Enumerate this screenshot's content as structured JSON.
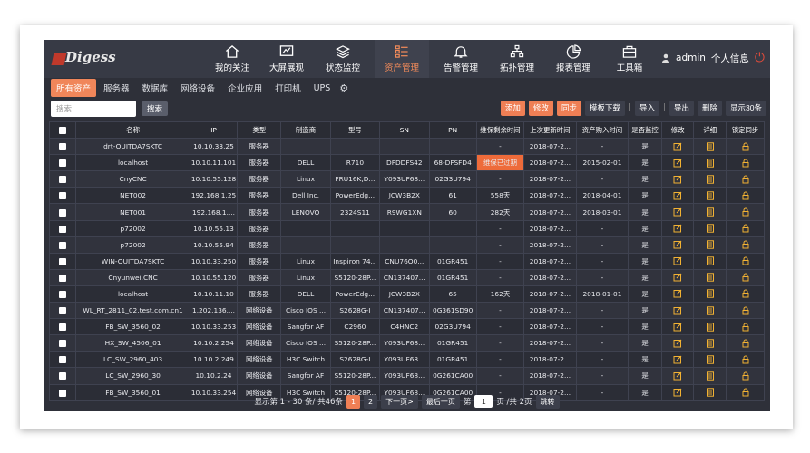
{
  "logo": {
    "text": "Digess"
  },
  "nav": [
    {
      "label": "我的关注",
      "icon": "home-icon"
    },
    {
      "label": "大屏展现",
      "icon": "screen-chart-icon"
    },
    {
      "label": "状态监控",
      "icon": "layers-icon"
    },
    {
      "label": "资产管理",
      "icon": "list-icon",
      "active": true
    },
    {
      "label": "告警管理",
      "icon": "bell-icon"
    },
    {
      "label": "拓扑管理",
      "icon": "topology-icon"
    },
    {
      "label": "报表管理",
      "icon": "pie-report-icon"
    },
    {
      "label": "工具箱",
      "icon": "toolbox-icon"
    }
  ],
  "user": {
    "name": "admin",
    "profile": "个人信息"
  },
  "subtabs": [
    "所有资产",
    "服务器",
    "数据库",
    "网络设备",
    "企业应用",
    "打印机",
    "UPS"
  ],
  "toolbar": {
    "search_placeholder": "搜索",
    "search_label": "搜索",
    "add": "添加",
    "edit": "修改",
    "sync": "同步",
    "template_download": "模板下载",
    "import": "导入",
    "export": "导出",
    "delete": "删除",
    "show30": "显示30条"
  },
  "table": {
    "headers": [
      "",
      "名称",
      "IP",
      "类型",
      "制造商",
      "型号",
      "SN",
      "PN",
      "维保剩余时间",
      "上次更新时间",
      "资产购入时间",
      "是否监控",
      "修改",
      "详细",
      "锁定同步"
    ],
    "rows": [
      [
        "drt-OUITDA7SKTC",
        "10.10.33.25",
        "服务器",
        "",
        "",
        "",
        "",
        "-",
        "2018-07-2...",
        "-",
        "是"
      ],
      [
        "localhost",
        "10.10.11.101",
        "服务器",
        "DELL",
        "R710",
        "DFDDFS42",
        "68-DFSFD4",
        "维保已过期",
        "2018-07-2...",
        "2015-02-01",
        "是"
      ],
      [
        "CnyCNC",
        "10.10.55.128",
        "服务器",
        "Linux",
        "FRU16K,D...",
        "Y093UF68...",
        "02G3U794",
        "-",
        "2018-07-2...",
        "-",
        "是"
      ],
      [
        "NET002",
        "192.168.1.25",
        "服务器",
        "Dell Inc.",
        "PowerEdg...",
        "JCW3B2X",
        "61",
        "558天",
        "2018-07-2...",
        "2018-04-01",
        "是"
      ],
      [
        "NET001",
        "192.168.1....",
        "服务器",
        "LENOVO",
        "2324S11",
        "R9WG1XN",
        "60",
        "282天",
        "2018-07-2...",
        "2018-03-01",
        "是"
      ],
      [
        "p72002",
        "10.10.55.13",
        "服务器",
        "",
        "",
        "",
        "",
        "-",
        "2018-07-2...",
        "-",
        "是"
      ],
      [
        "p72002",
        "10.10.55.94",
        "服务器",
        "",
        "",
        "",
        "",
        "-",
        "2018-07-2...",
        "-",
        "是"
      ],
      [
        "WIN-OUITDA7SKTC",
        "10.10.33.250",
        "服务器",
        "Linux",
        "Inspiron 74...",
        "CNU76O0...",
        "01GR451",
        "-",
        "2018-07-2...",
        "-",
        "是"
      ],
      [
        "Cnyunwei.CNC",
        "10.10.55.120",
        "服务器",
        "Linux",
        "S5120-28P...",
        "CN137407...",
        "01GR451",
        "-",
        "2018-07-2...",
        "-",
        "是"
      ],
      [
        "localhost",
        "10.10.11.10",
        "服务器",
        "DELL",
        "PowerEdg...",
        "JCW3B2X",
        "65",
        "162天",
        "2018-07-2...",
        "2018-01-01",
        "是"
      ],
      [
        "WL_RT_2811_02.test.com.cn1",
        "1.202.136....",
        "网络设备",
        "Cisco IOS ...",
        "S2628G-I",
        "CN137407...",
        "0G361SD90",
        "-",
        "2018-07-2...",
        "-",
        "是"
      ],
      [
        "FB_SW_3560_02",
        "10.10.33.253",
        "网络设备",
        "Sangfor AF",
        "C2960",
        "C4HNC2",
        "02G3U794",
        "-",
        "2018-07-2...",
        "-",
        "是"
      ],
      [
        "HX_SW_4506_01",
        "10.10.2.254",
        "网络设备",
        "Cisco IOS ...",
        "S5120-28P...",
        "Y093UF68...",
        "01GR451",
        "-",
        "2018-07-2...",
        "-",
        "是"
      ],
      [
        "LC_SW_2960_403",
        "10.10.2.249",
        "网络设备",
        "H3C Switch",
        "S2628G-I",
        "Y093UF68...",
        "01GR451",
        "-",
        "2018-07-2...",
        "-",
        "是"
      ],
      [
        "LC_SW_2960_30",
        "10.10.2.24",
        "网络设备",
        "Sangfor AF",
        "S5120-28P...",
        "Y093UF68...",
        "0G261CA00",
        "-",
        "2018-07-2...",
        "-",
        "是"
      ],
      [
        "FB_SW_3560_01",
        "10.10.33.254",
        "网络设备",
        "H3C Switch",
        "S5120-28P...",
        "Y093UF68...",
        "0G261CA00",
        "-",
        "2018-07-2...",
        "-",
        "是"
      ]
    ]
  },
  "pager": {
    "summary": "显示第 1 - 30 条/ 共46条",
    "pages": [
      "1",
      "2"
    ],
    "next": "下一页>",
    "last": "最后一页",
    "goto_prefix": "第",
    "current": "1",
    "goto_suffix": "页 /共 2页",
    "jump": "跳转"
  },
  "colors": {
    "accent": "#ef7f55",
    "warning_cell": "#ee6b3a",
    "background": "#2e3039",
    "icon_yellow": "#f2b233",
    "power": "#e04b3b"
  }
}
